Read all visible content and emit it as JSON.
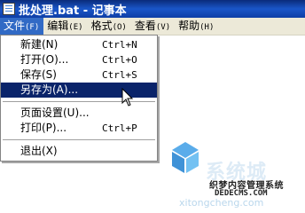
{
  "window": {
    "title": "批处理.bat - 记事本"
  },
  "menubar": {
    "items": [
      {
        "label": "文件",
        "accel": "(F)"
      },
      {
        "label": "编辑",
        "accel": "(E)"
      },
      {
        "label": "格式",
        "accel": "(O)"
      },
      {
        "label": "查看",
        "accel": "(V)"
      },
      {
        "label": "帮助",
        "accel": "(H)"
      }
    ]
  },
  "file_menu": {
    "items": [
      {
        "label": "新建(N)",
        "shortcut": "Ctrl+N"
      },
      {
        "label": "打开(O)...",
        "shortcut": "Ctrl+O"
      },
      {
        "label": "保存(S)",
        "shortcut": "Ctrl+S"
      },
      {
        "label": "另存为(A)...",
        "shortcut": "",
        "highlighted": true
      },
      {
        "label": "页面设置(U)...",
        "shortcut": ""
      },
      {
        "label": "打印(P)...",
        "shortcut": "Ctrl+P"
      },
      {
        "label": "退出(X)",
        "shortcut": ""
      }
    ]
  },
  "watermark": {
    "brand": "系统城",
    "tagline": "织梦内容管理系统",
    "url": "DEDECMS.COM",
    "domain": "xitongcheng.com"
  },
  "colors": {
    "titlebar": "#1a56c8",
    "menu_highlight": "#0a246a",
    "menubar_open": "#316ac5",
    "menubar_bg": "#ece9d8"
  }
}
